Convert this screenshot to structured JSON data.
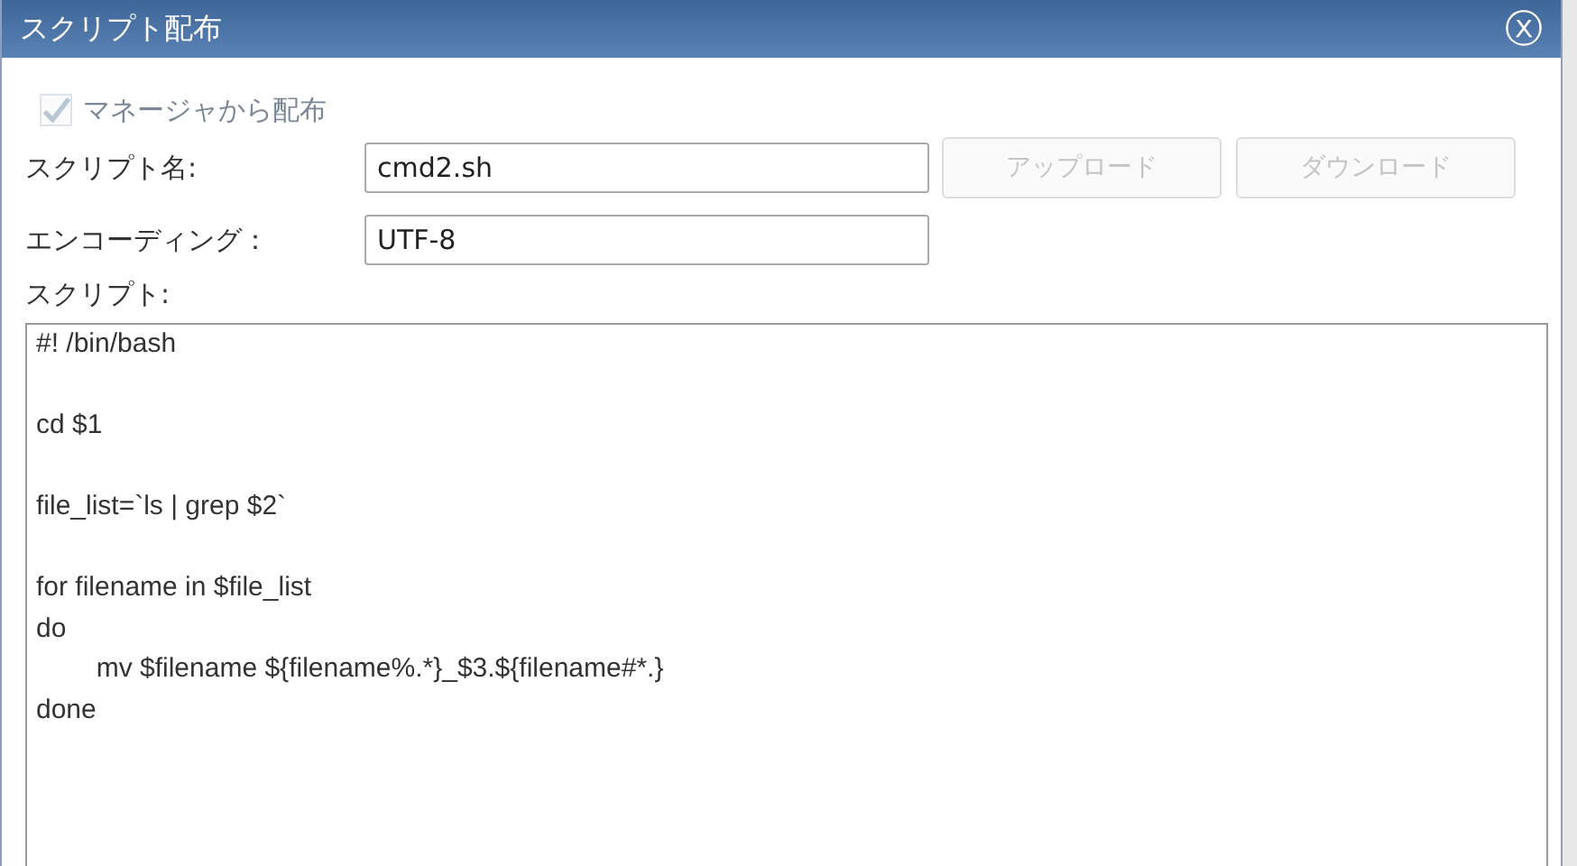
{
  "window": {
    "title": "スクリプト配布",
    "close": "ⓧ"
  },
  "distribute_from_manager": {
    "label": "マネージャから配布",
    "checked": true,
    "disabled": true
  },
  "script_name": {
    "label": "スクリプト名:",
    "value": "cmd2.sh"
  },
  "buttons": [
    {
      "label": "アップロード",
      "disabled": true
    },
    {
      "label": "ダウンロード",
      "disabled": true
    }
  ],
  "encoding": {
    "label": "エンコーディング：",
    "value": "UTF-8"
  },
  "script": {
    "label": "スクリプト:",
    "value": "#! /bin/bash\n\ncd $1\n\nfile_list=`ls | grep $2`\n\nfor filename in $file_list\ndo\n\tmv $filename ${filename%.*}_$3.${filename#*.}\ndone"
  }
}
